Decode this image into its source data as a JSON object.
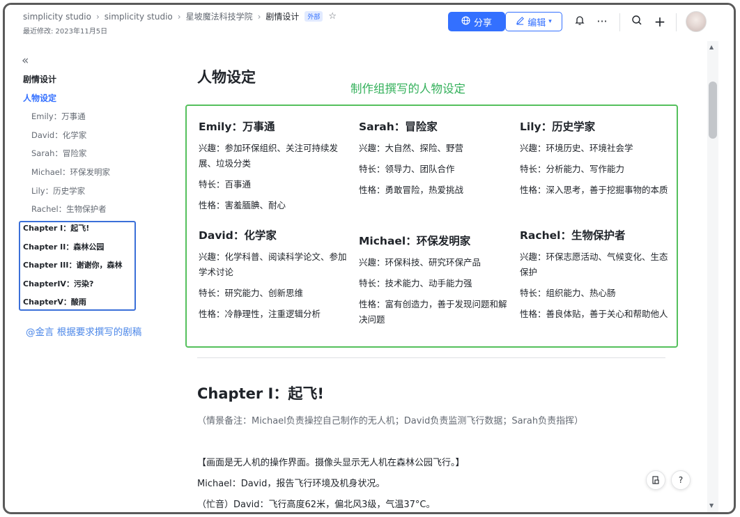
{
  "header": {
    "breadcrumb": [
      "simplicity studio",
      "simplicity studio",
      "星坡魔法科技学院",
      "剧情设计"
    ],
    "badge": "外部",
    "last_modified": "最近修改: 2023年11月5日",
    "share_label": "分享",
    "edit_label": "编辑"
  },
  "sidebar": {
    "collapse": "«",
    "title": "剧情设计",
    "active_item": "人物设定",
    "sub_items": [
      "Emily：万事通",
      "David：化学家",
      "Sarah：冒险家",
      "Michael：环保发明家",
      "Lily：历史学家",
      "Rachel：生物保护者"
    ],
    "chapters": [
      "Chapter I：起飞!",
      "Chapter II：森林公园",
      "Chapter III：谢谢你，森林",
      "ChapterIV：污染?",
      "ChapterV：酸雨"
    ],
    "note": "@金言 根据要求撰写的剧稿"
  },
  "main": {
    "heading": "人物设定",
    "green_note": "制作组撰写的人物设定",
    "characters": [
      {
        "name": "Emily：万事通",
        "interest": "兴趣：参加环保组织、关注可持续发展、垃圾分类",
        "skill": "特长：百事通",
        "personality": "性格：害羞腼腆、耐心"
      },
      {
        "name": "Sarah：冒险家",
        "interest": "兴趣：大自然、探险、野营",
        "skill": "特长：领导力、团队合作",
        "personality": "性格：勇敢冒险，热爱挑战"
      },
      {
        "name": "Lily：历史学家",
        "interest": "兴趣：环境历史、环境社会学",
        "skill": "特长：分析能力、写作能力",
        "personality": "性格：深入思考，善于挖掘事物的本质"
      },
      {
        "name": "David：化学家",
        "interest": "兴趣：化学科普、阅读科学论文、参加学术讨论",
        "skill": "特长：研究能力、创新思维",
        "personality": "性格：冷静理性，注重逻辑分析"
      },
      {
        "name": "Michael：环保发明家",
        "interest": "兴趣：环保科技、研究环保产品",
        "skill": "特长：技术能力、动手能力强",
        "personality": "性格：富有创造力，善于发现问题和解决问题"
      },
      {
        "name": "Rachel：生物保护者",
        "interest": "兴趣：环保志愿活动、气候变化、生态保护",
        "skill": "特长：组织能力、热心肠",
        "personality": "性格：善良体贴，善于关心和帮助他人"
      }
    ],
    "chapter_heading": "Chapter I：起飞!",
    "scene_note": "（情景备注：Michael负责操控自己制作的无人机；David负责监测飞行数据；Sarah负责指挥）",
    "lines": [
      "【画面是无人机的操作界面。摄像头显示无人机在森林公园飞行。】",
      "Michael：David，报告飞行环境及机身状况。",
      "（忙音）David：飞行高度62米，偏北风3级，气温37°C。"
    ]
  }
}
